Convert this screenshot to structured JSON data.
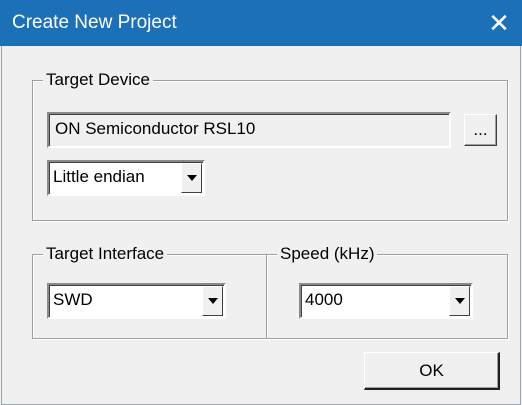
{
  "window": {
    "title": "Create New Project",
    "close_glyph": "✕"
  },
  "target_device": {
    "legend": "Target Device",
    "device_value": "ON Semiconductor RSL10",
    "browse_label": "...",
    "endian_value": "Little endian"
  },
  "target_interface": {
    "legend": "Target Interface",
    "value": "SWD"
  },
  "speed": {
    "legend": "Speed (kHz)",
    "value": "4000"
  },
  "buttons": {
    "ok_label": "OK"
  },
  "colors": {
    "titlebar": "#1c70b8",
    "dialog_bg": "#f0f0f0"
  }
}
